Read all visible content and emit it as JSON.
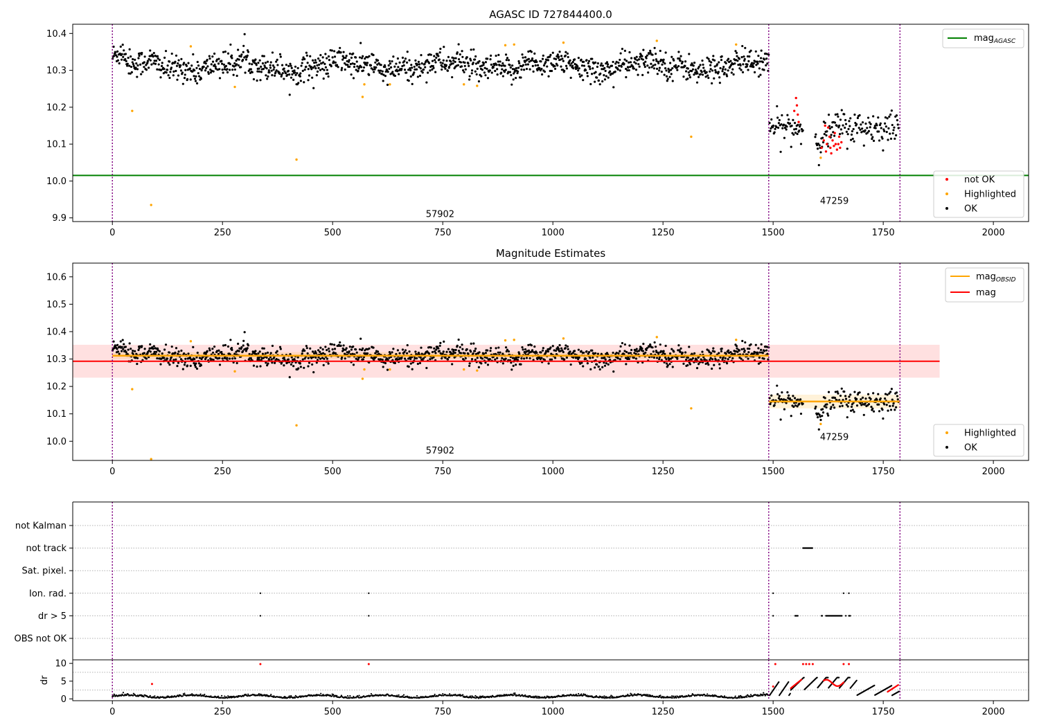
{
  "chart_data": [
    {
      "type": "scatter",
      "name": "magnitude-timeline",
      "title": "AGASC ID 727844400.0",
      "xlim": [
        -90,
        2080
      ],
      "ylim": [
        9.89,
        10.425
      ],
      "xticks": [
        0,
        250,
        500,
        750,
        1000,
        1250,
        1500,
        1750,
        2000
      ],
      "yticks": [
        9.9,
        10.0,
        10.1,
        10.2,
        10.3,
        10.4
      ],
      "ytick_labels": [
        "9.9",
        "10.0",
        "10.1",
        "10.2",
        "10.3",
        "10.4"
      ],
      "obs_boundaries": [
        0,
        1490,
        1788
      ],
      "obs_labels": [
        {
          "x": 744,
          "y": 9.91,
          "text": "57902"
        },
        {
          "x": 1639,
          "y": 9.945,
          "text": "47259"
        }
      ],
      "lines": [
        {
          "name": "mag",
          "sub": "AGASC",
          "color": "#008000",
          "y": 10.015,
          "x_range": [
            -90,
            2080
          ]
        }
      ],
      "series": [
        {
          "name": "not OK",
          "color": "#ff0000"
        },
        {
          "name": "Highlighted",
          "color": "#ffa500"
        },
        {
          "name": "OK",
          "color": "#000000"
        }
      ],
      "obs_segments": [
        {
          "x_range": [
            0,
            1490
          ],
          "center": 10.312,
          "spread": 0.018
        },
        {
          "x_range": [
            1490,
            1788
          ],
          "center": 10.145,
          "spread": 0.022
        }
      ],
      "highlighted_points": [
        [
          45,
          10.19
        ],
        [
          88,
          9.935
        ],
        [
          178,
          10.365
        ],
        [
          278,
          10.255
        ],
        [
          418,
          10.058
        ],
        [
          568,
          10.228
        ],
        [
          572,
          10.262
        ],
        [
          630,
          10.262
        ],
        [
          798,
          10.262
        ],
        [
          828,
          10.258
        ],
        [
          892,
          10.368
        ],
        [
          912,
          10.37
        ],
        [
          1024,
          10.375
        ],
        [
          1236,
          10.38
        ],
        [
          1314,
          10.12
        ],
        [
          1416,
          10.37
        ],
        [
          1608,
          10.063
        ]
      ],
      "notok_points": [
        [
          1552,
          10.225
        ],
        [
          1554,
          10.205
        ],
        [
          1556,
          10.18
        ],
        [
          1558,
          10.16
        ],
        [
          1548,
          10.19
        ],
        [
          1610,
          10.09
        ],
        [
          1615,
          10.11
        ],
        [
          1618,
          10.15
        ],
        [
          1620,
          10.08
        ],
        [
          1622,
          10.1
        ],
        [
          1625,
          10.145
        ],
        [
          1628,
          10.12
        ],
        [
          1630,
          10.09
        ],
        [
          1632,
          10.075
        ],
        [
          1635,
          10.11
        ],
        [
          1638,
          10.095
        ],
        [
          1640,
          10.13
        ],
        [
          1642,
          10.1
        ],
        [
          1645,
          10.085
        ],
        [
          1648,
          10.1
        ],
        [
          1650,
          10.12
        ],
        [
          1652,
          10.09
        ],
        [
          1655,
          10.105
        ]
      ],
      "legend": {
        "lines_position": "top-right",
        "markers_position": "lower-right"
      }
    },
    {
      "type": "scatter",
      "name": "magnitude-estimates",
      "title": "Magnitude Estimates",
      "xlim": [
        -90,
        2080
      ],
      "ylim": [
        9.93,
        10.65
      ],
      "xticks": [
        0,
        250,
        500,
        750,
        1000,
        1250,
        1500,
        1750,
        2000
      ],
      "yticks": [
        10.0,
        10.1,
        10.2,
        10.3,
        10.4,
        10.5,
        10.6
      ],
      "ytick_labels": [
        "10.0",
        "10.1",
        "10.2",
        "10.3",
        "10.4",
        "10.5",
        "10.6"
      ],
      "obs_boundaries": [
        0,
        1490,
        1788
      ],
      "obs_labels": [
        {
          "x": 744,
          "y": 9.965,
          "text": "57902"
        },
        {
          "x": 1639,
          "y": 10.015,
          "text": "47259"
        }
      ],
      "lines": [
        {
          "name": "mag",
          "sub": "OBSID",
          "color": "#ffa500",
          "segments": [
            {
              "x_range": [
                0,
                1490
              ],
              "y": 10.312,
              "band": [
                10.3,
                10.325
              ]
            },
            {
              "x_range": [
                1490,
                1788
              ],
              "y": 10.145,
              "band": [
                10.12,
                10.17
              ]
            }
          ]
        },
        {
          "name": "mag",
          "sub": "",
          "color": "#ff0000",
          "y": 10.292,
          "x_range": [
            -90,
            1878
          ],
          "band": [
            10.232,
            10.352
          ]
        }
      ],
      "series": [
        {
          "name": "Highlighted",
          "color": "#ffa500"
        },
        {
          "name": "OK",
          "color": "#000000"
        }
      ],
      "legend": {
        "lines_position": "top-right",
        "markers_position": "lower-right"
      }
    },
    {
      "type": "scatter",
      "name": "flags",
      "xlim": [
        -90,
        2080
      ],
      "categories": [
        "not Kalman",
        "not track",
        "Sat. pixel.",
        "Ion. rad.",
        "dr > 5",
        "OBS not OK"
      ],
      "obs_boundaries": [
        0,
        1490,
        1788
      ],
      "flag_points": {
        "not track": [
          [
            1568,
            1590
          ]
        ],
        "Ion. rad.": [
          [
            336,
            336
          ],
          [
            582,
            582
          ],
          [
            1500,
            1500
          ],
          [
            1660,
            1660
          ],
          [
            1672,
            1672
          ]
        ],
        "dr > 5": [
          [
            336,
            336
          ],
          [
            582,
            582
          ],
          [
            1500,
            1500
          ],
          [
            1550,
            1556
          ],
          [
            1610,
            1612
          ],
          [
            1620,
            1656
          ],
          [
            1665,
            1665
          ],
          [
            1672,
            1676
          ]
        ]
      }
    },
    {
      "type": "scatter",
      "name": "dr",
      "ylabel": "dr",
      "xlim": [
        -90,
        2080
      ],
      "ylim": [
        -0.5,
        11
      ],
      "xticks": [
        0,
        250,
        500,
        750,
        1000,
        1250,
        1500,
        1750,
        2000
      ],
      "yticks": [
        0,
        5,
        10
      ],
      "ytick_labels": [
        "0",
        "5",
        "10"
      ],
      "obs_boundaries": [
        0,
        1490,
        1788
      ],
      "red_points": [
        [
          90,
          4.2
        ],
        [
          336,
          9.8
        ],
        [
          582,
          9.8
        ],
        [
          1500,
          3.5
        ],
        [
          1505,
          9.8
        ],
        [
          1568,
          9.8
        ],
        [
          1575,
          9.8
        ],
        [
          1582,
          9.8
        ],
        [
          1590,
          9.8
        ],
        [
          1660,
          9.8
        ],
        [
          1672,
          9.8
        ]
      ]
    }
  ]
}
